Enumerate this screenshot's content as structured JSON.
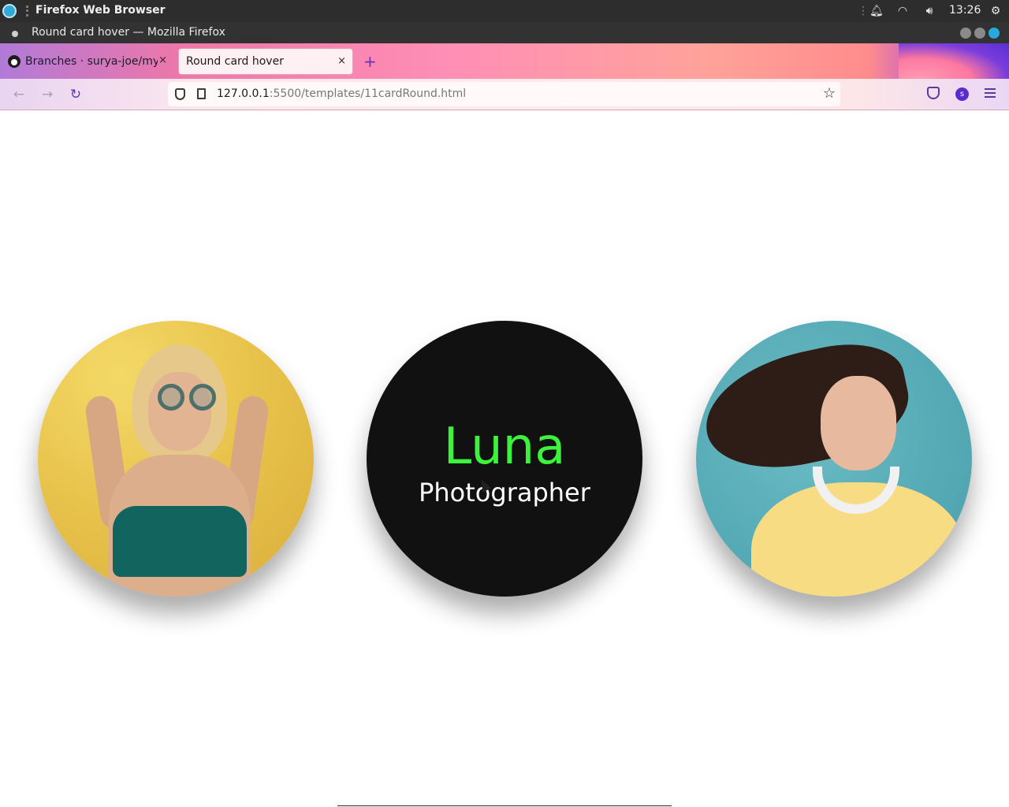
{
  "os_bar": {
    "app_name": "Firefox Web Browser",
    "clock": "13:26",
    "icons": [
      "notification-bell-icon",
      "wifi-icon",
      "volume-icon",
      "settings-icon"
    ]
  },
  "window": {
    "title": "Round card hover — Mozilla Firefox"
  },
  "tabs": [
    {
      "label": "Branches · surya-joe/myW",
      "icon": "github-icon",
      "active": false
    },
    {
      "label": "Round card hover",
      "active": true
    }
  ],
  "tab_close_glyph": "×",
  "new_tab_glyph": "+",
  "nav": {
    "url_host": "127.0.0.1",
    "url_rest": ":5500/templates/11cardRound.html",
    "profile_initial": "s"
  },
  "cards": {
    "left": {
      "type": "photo",
      "subject": "woman with round sunglasses on yellow background"
    },
    "center": {
      "name": "Luna",
      "role": "Photographer",
      "name_color": "#3cf23c"
    },
    "right": {
      "type": "photo",
      "subject": "woman with headphones on teal background"
    }
  },
  "colors": {
    "card_center_bg": "#111111",
    "accent_purple": "#6b2fc8"
  }
}
